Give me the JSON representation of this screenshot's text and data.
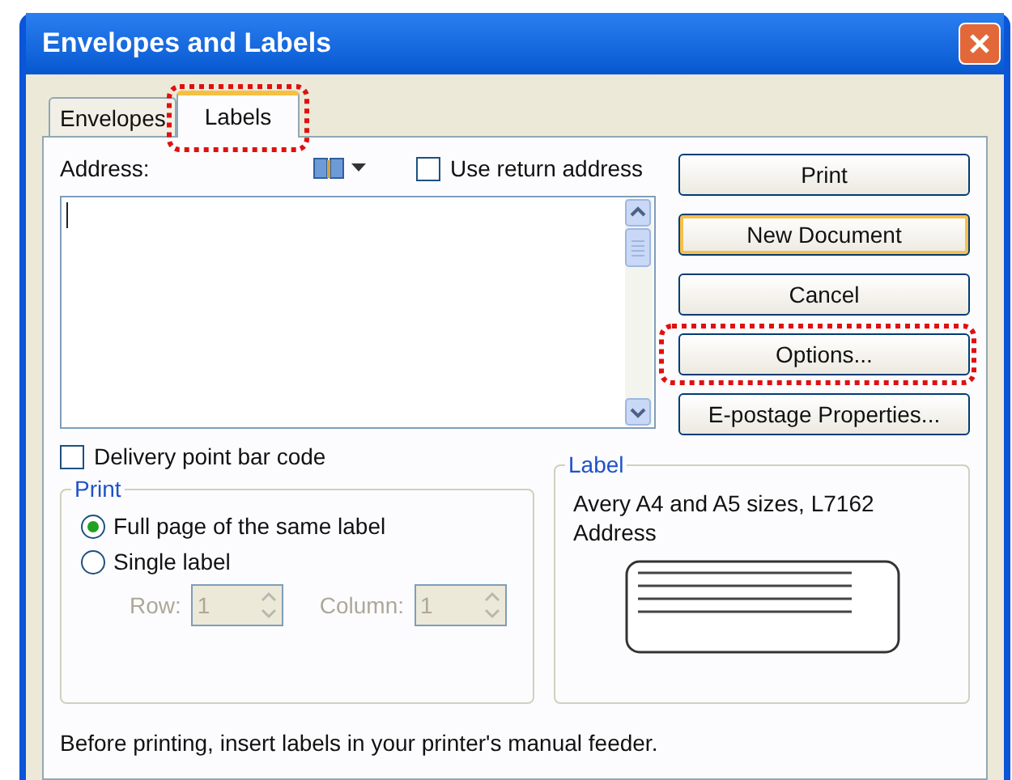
{
  "window": {
    "title": "Envelopes and Labels"
  },
  "tabs": [
    {
      "label": "Envelopes",
      "selected": false,
      "highlighted": false
    },
    {
      "label": "Labels",
      "selected": true,
      "highlighted": true
    }
  ],
  "address": {
    "label": "Address:",
    "use_return_address": {
      "label": "Use return address",
      "checked": false
    }
  },
  "delivery_point_bar_code": {
    "label": "Delivery point bar code",
    "checked": false
  },
  "buttons": [
    {
      "label": "Print",
      "default": false,
      "highlighted": false
    },
    {
      "label": "New Document",
      "default": true,
      "highlighted": false
    },
    {
      "label": "Cancel",
      "default": false,
      "highlighted": false
    },
    {
      "label": "Options...",
      "default": false,
      "highlighted": true
    },
    {
      "label": "E-postage Properties...",
      "default": false,
      "highlighted": false
    }
  ],
  "print_group": {
    "title": "Print",
    "options": [
      {
        "label": "Full page of the same label",
        "selected": true
      },
      {
        "label": "Single label",
        "selected": false
      }
    ],
    "row": {
      "label": "Row:",
      "value": "1",
      "disabled": true
    },
    "column": {
      "label": "Column:",
      "value": "1",
      "disabled": true
    }
  },
  "label_group": {
    "title": "Label",
    "lines": [
      "Avery A4 and A5 sizes, L7162",
      "Address"
    ]
  },
  "footer": "Before printing, insert labels in your printer's manual feeder."
}
